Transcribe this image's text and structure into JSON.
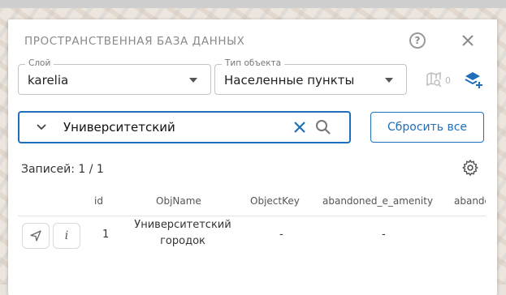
{
  "panel": {
    "title": "ПРОСТРАНСТВЕННАЯ БАЗА ДАННЫХ",
    "help_icon_label": "?"
  },
  "filters": {
    "layer": {
      "label": "Слой",
      "value": "karelia"
    },
    "object_type": {
      "label": "Тип объекта",
      "value": "Населенные пункты"
    },
    "map_count": "0"
  },
  "search": {
    "value": "Университетский"
  },
  "reset_button_label": "Сбросить все",
  "records_label": "Записей: 1 / 1",
  "table": {
    "columns": [
      "id",
      "ObjName",
      "ObjectKey",
      "abandoned_e_amenity",
      "abando"
    ],
    "rows": [
      {
        "id": "1",
        "obj_name_line1": "Университетский",
        "obj_name_line2": "городок",
        "object_key": "-",
        "abandoned_amenity": "-"
      }
    ],
    "info_button_label": "i"
  },
  "colors": {
    "accent": "#1f6fba",
    "muted": "#8a8a8a"
  },
  "icons": [
    "help-icon",
    "close-icon",
    "map-search-icon",
    "layers-add-icon",
    "chevron-down-icon",
    "clear-icon",
    "search-icon",
    "gear-icon",
    "navigate-icon",
    "info-icon"
  ]
}
